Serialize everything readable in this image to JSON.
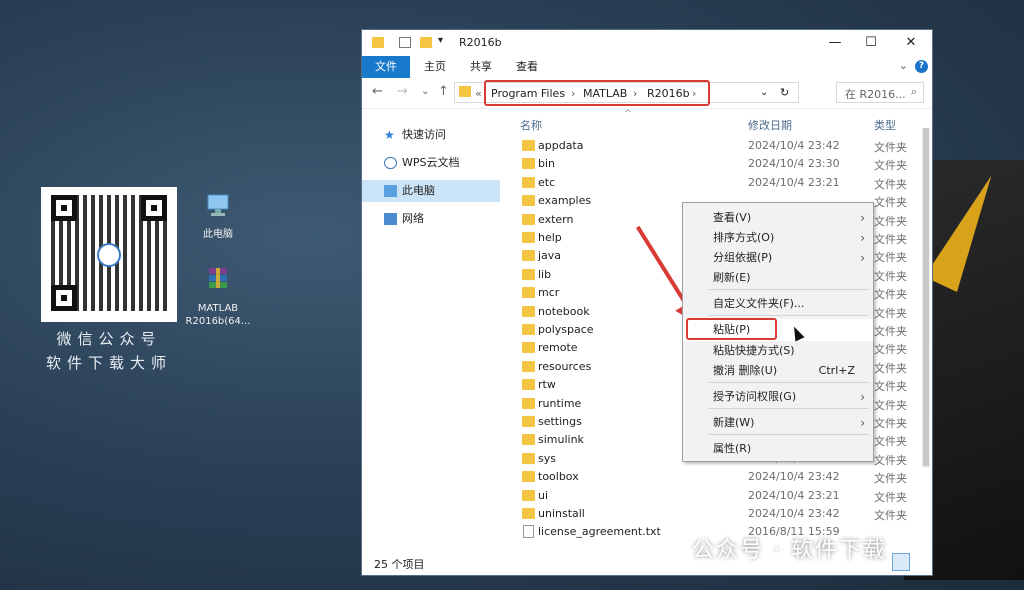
{
  "desktop": {
    "qr_caption_line1": "微信公众号",
    "qr_caption_line2": "软件下载大师",
    "icons": [
      {
        "label": "此电脑"
      },
      {
        "label_line1": "MATLAB",
        "label_line2": "R2016b(64..."
      }
    ],
    "watermark": "公众号 · 软件下载"
  },
  "window": {
    "title": "R2016b",
    "controls": {
      "minimize": "—",
      "maximize": "☐",
      "close": "✕"
    },
    "ribbon": {
      "file": "文件",
      "tabs": [
        "主页",
        "共享",
        "查看"
      ],
      "help": "?",
      "expand": "⌄"
    },
    "nav": {
      "back": "←",
      "forward": "→",
      "recent": "⌄",
      "up": "↑",
      "overflow": "«",
      "refresh": "↻",
      "dropdown": "⌄"
    },
    "breadcrumb": [
      "Program Files",
      "MATLAB",
      "R2016b"
    ],
    "search_placeholder": "在 R2016...",
    "sidebar": [
      {
        "label": "快速访问"
      },
      {
        "label": "WPS云文档"
      },
      {
        "label": "此电脑",
        "selected": true
      },
      {
        "label": "网络"
      }
    ],
    "columns": {
      "name": "名称",
      "date": "修改日期",
      "type": "类型"
    },
    "files": [
      {
        "name": "appdata",
        "date": "2024/10/4 23:42",
        "type": "文件夹"
      },
      {
        "name": "bin",
        "date": "2024/10/4 23:30",
        "type": "文件夹"
      },
      {
        "name": "etc",
        "date": "2024/10/4 23:21",
        "type": "文件夹"
      },
      {
        "name": "examples",
        "date": "",
        "type": "文件夹"
      },
      {
        "name": "extern",
        "date": "",
        "type": "文件夹"
      },
      {
        "name": "help",
        "date": "",
        "type": "文件夹"
      },
      {
        "name": "java",
        "date": "",
        "type": "文件夹"
      },
      {
        "name": "lib",
        "date": "",
        "type": "文件夹"
      },
      {
        "name": "mcr",
        "date": "",
        "type": "文件夹"
      },
      {
        "name": "notebook",
        "date": "",
        "type": "文件夹"
      },
      {
        "name": "polyspace",
        "date": "",
        "type": "文件夹"
      },
      {
        "name": "remote",
        "date": "",
        "type": "文件夹"
      },
      {
        "name": "resources",
        "date": "",
        "type": "文件夹"
      },
      {
        "name": "rtw",
        "date": "",
        "type": "文件夹"
      },
      {
        "name": "runtime",
        "date": "",
        "type": "文件夹"
      },
      {
        "name": "settings",
        "date": "",
        "type": "文件夹"
      },
      {
        "name": "simulink",
        "date": "",
        "type": "文件夹"
      },
      {
        "name": "sys",
        "date": "2024/10/4 23:31",
        "type": "文件夹"
      },
      {
        "name": "toolbox",
        "date": "2024/10/4 23:42",
        "type": "文件夹"
      },
      {
        "name": "ui",
        "date": "2024/10/4 23:21",
        "type": "文件夹"
      },
      {
        "name": "uninstall",
        "date": "2024/10/4 23:42",
        "type": "文件夹"
      },
      {
        "name": "license_agreement.txt",
        "date": "2016/8/11 15:59",
        "type": ""
      }
    ],
    "status": "25 个项目"
  },
  "context_menu": [
    {
      "label": "查看(V)",
      "submenu": true
    },
    {
      "label": "排序方式(O)",
      "submenu": true
    },
    {
      "label": "分组依据(P)",
      "submenu": true
    },
    {
      "label": "刷新(E)"
    },
    {
      "label": "自定义文件夹(F)..."
    },
    {
      "label": "粘贴(P)",
      "highlighted": true
    },
    {
      "label": "粘贴快捷方式(S)"
    },
    {
      "label": "撤消 删除(U)",
      "shortcut": "Ctrl+Z"
    },
    {
      "label": "授予访问权限(G)",
      "submenu": true
    },
    {
      "label": "新建(W)",
      "submenu": true
    },
    {
      "label": "属性(R)"
    }
  ],
  "colors": {
    "accent": "#1979ca",
    "annotation": "#d83a35",
    "folder": "#f4c542",
    "selection": "#cce4f7"
  }
}
